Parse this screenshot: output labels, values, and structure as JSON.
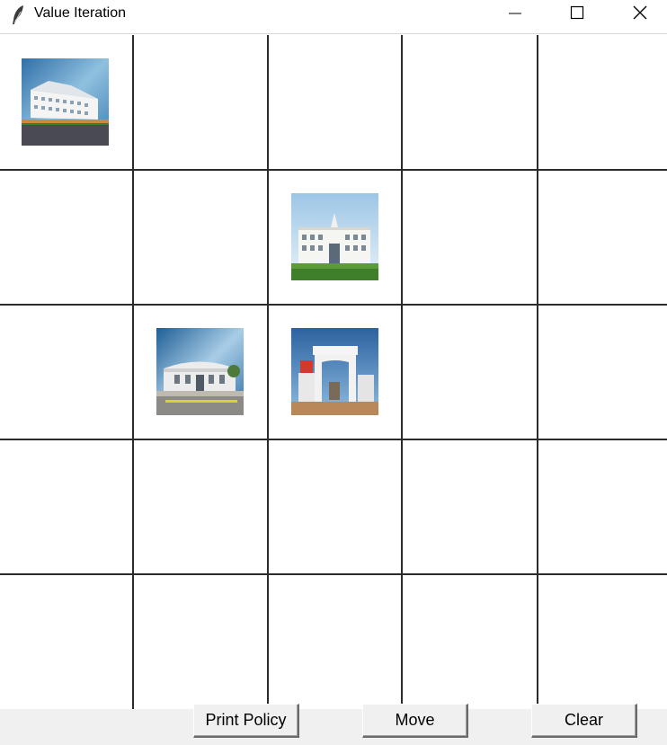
{
  "window": {
    "title": "Value Iteration",
    "icon": "feather-icon",
    "controls": [
      "minimize-icon",
      "maximize-icon",
      "close-icon"
    ]
  },
  "grid": {
    "rows": 5,
    "cols": 5,
    "images": [
      {
        "row": 0,
        "col": 0,
        "subject": "building-photo"
      },
      {
        "row": 1,
        "col": 2,
        "subject": "building-photo"
      },
      {
        "row": 2,
        "col": 1,
        "subject": "building-photo"
      },
      {
        "row": 2,
        "col": 2,
        "subject": "gate-photo"
      }
    ]
  },
  "buttons": {
    "print_policy": "Print Policy",
    "move": "Move",
    "clear": "Clear"
  }
}
